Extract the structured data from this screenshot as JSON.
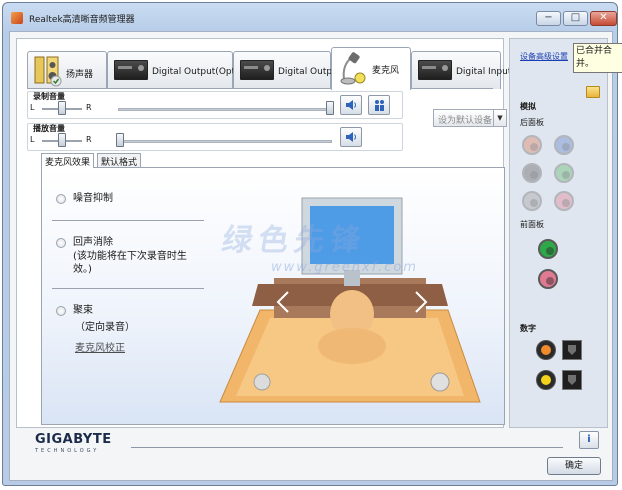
{
  "window": {
    "title": "Realtek高清晰音频管理器",
    "controls": {
      "minimize": "−",
      "maximize": "□",
      "close": "✕"
    }
  },
  "tabs": [
    {
      "label": "扬声器",
      "active": false,
      "icon": "speaker-icon"
    },
    {
      "label": "Digital Output(Optical)",
      "active": false,
      "icon": "digital-device-icon"
    },
    {
      "label": "Digital Output",
      "active": false,
      "icon": "digital-device-icon"
    },
    {
      "label": "麦克风",
      "active": true,
      "icon": "microphone-icon"
    },
    {
      "label": "Digital Input",
      "active": false,
      "icon": "digital-device-icon"
    }
  ],
  "record_volume": {
    "title": "录制音量",
    "left_label": "L",
    "right_label": "R",
    "balance": 0.5,
    "level": 1.0
  },
  "playback_volume": {
    "title": "播放音量",
    "left_label": "L",
    "right_label": "R",
    "balance": 0.5,
    "level": 0.0
  },
  "default_device": {
    "label": "设为默认设备",
    "arrow": "▼"
  },
  "subtabs": [
    {
      "label": "麦克风效果",
      "active": true
    },
    {
      "label": "默认格式",
      "active": false
    }
  ],
  "effects": {
    "noise_suppression": "噪音抑制",
    "echo_cancellation": "回声消除",
    "echo_note_line1": "(该功能将在下次录音时生",
    "echo_note_line2": "效。)",
    "beamforming": "聚束",
    "beamforming_note": "（定向录音）",
    "calibration_link": "麦克风校正"
  },
  "watermark": {
    "main": "绿色先锋",
    "url": "www.greenxf.com"
  },
  "side": {
    "advanced_link": "设备高级设置",
    "tooltip": "已合并合并。",
    "analog_label": "模拟",
    "back_panel_label": "后面板",
    "front_panel_label": "前面板",
    "digital_label": "数字",
    "back_jacks": [
      {
        "color": "#e08a6c",
        "active": false
      },
      {
        "color": "#6e8fd2",
        "active": false
      },
      {
        "color": "#6e6e6e",
        "active": false
      },
      {
        "color": "#6fbf7a",
        "active": false
      },
      {
        "color": "#a9a9a9",
        "active": false
      },
      {
        "color": "#e48c9e",
        "active": false
      }
    ],
    "front_jacks": [
      {
        "color": "#2fa84a",
        "active": true
      },
      {
        "color": "#e07a93",
        "active": true
      }
    ],
    "digital_colors": [
      "#f08a2a",
      "#f2d21a"
    ]
  },
  "footer": {
    "logo_main": "GIGABYTE",
    "logo_sub": "TECHNOLOGY",
    "info_icon": "i",
    "ok_label": "确定"
  }
}
